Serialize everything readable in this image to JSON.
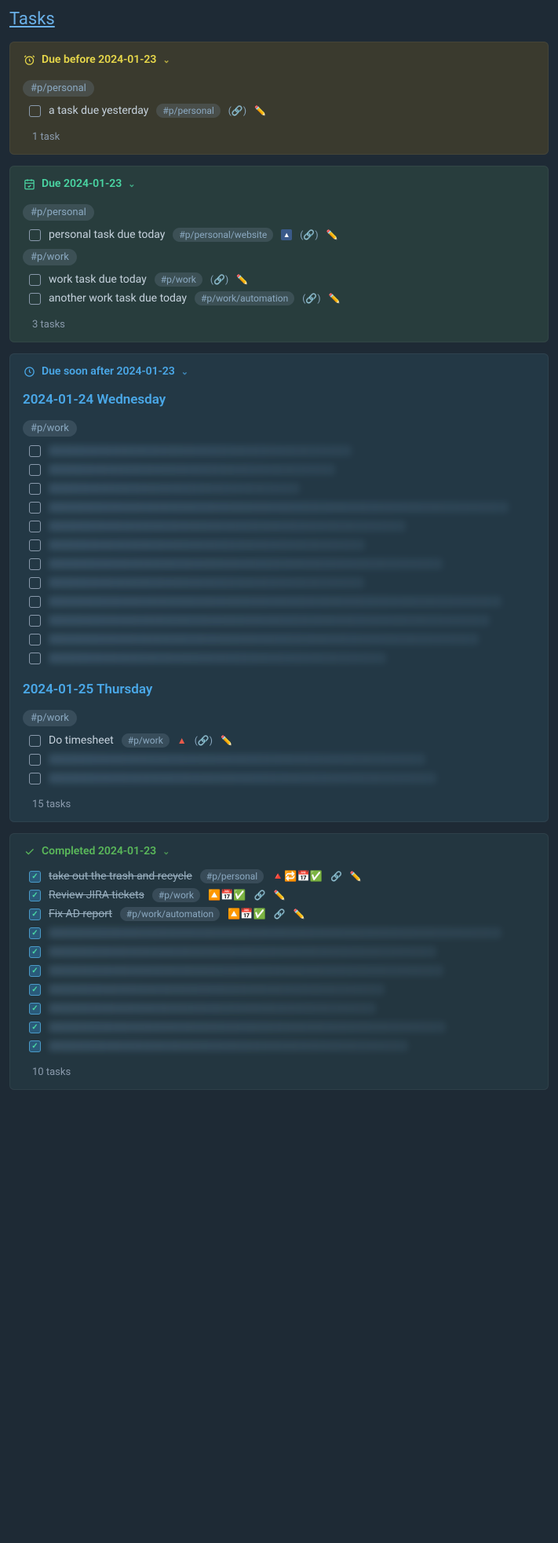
{
  "page_title": "Tasks",
  "sections": {
    "overdue": {
      "header": "Due before 2024-01-23",
      "groups": [
        {
          "tag": "#p/personal",
          "tasks": [
            {
              "text": "a task due yesterday",
              "tag": "#p/personal"
            }
          ]
        }
      ],
      "count": "1 task"
    },
    "today": {
      "header": "Due 2024-01-23",
      "groups": [
        {
          "tag": "#p/personal",
          "tasks": [
            {
              "text": "personal task due today",
              "tag": "#p/personal/website",
              "priority": "up"
            }
          ]
        },
        {
          "tag": "#p/work",
          "tasks": [
            {
              "text": "work task due today",
              "tag": "#p/work"
            },
            {
              "text": "another work task due today",
              "tag": "#p/work/automation"
            }
          ]
        }
      ],
      "count": "3 tasks"
    },
    "soon": {
      "header": "Due soon after 2024-01-23",
      "days": [
        {
          "date": "2024-01-24 Wednesday",
          "groups": [
            {
              "tag": "#p/work",
              "blurred_count": 12
            }
          ]
        },
        {
          "date": "2024-01-25 Thursday",
          "groups": [
            {
              "tag": "#p/work",
              "tasks": [
                {
                  "text": "Do timesheet",
                  "tag": "#p/work",
                  "priority": "high"
                }
              ],
              "blurred_count": 2
            }
          ]
        }
      ],
      "count": "15 tasks"
    },
    "completed": {
      "header": "Completed 2024-01-23",
      "tasks": [
        {
          "text": "take out the trash and recycle",
          "tag": "#p/personal",
          "emojis": "🔺🔁📅✅"
        },
        {
          "text": "Review JIRA tickets",
          "tag": "#p/work",
          "emojis": "🔼📅✅"
        },
        {
          "text": "Fix AD report",
          "tag": "#p/work/automation",
          "emojis": "🔼📅✅"
        }
      ],
      "blurred_count": 7,
      "count": "10 tasks"
    }
  }
}
